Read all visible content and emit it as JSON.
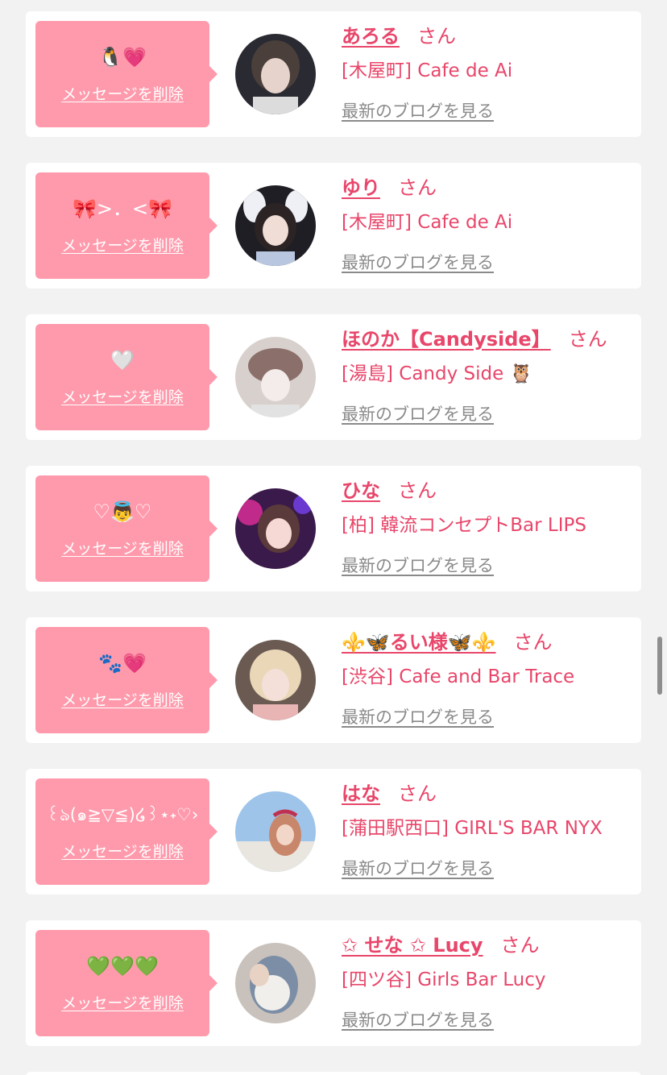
{
  "list": {
    "delete_label": "メッセージを削除",
    "blog_label": "最新のブログを見る",
    "honorific": "さん",
    "items": [
      {
        "message": "🐧💗",
        "name": "あろる",
        "shop": "[木屋町] Cafe de Ai"
      },
      {
        "message": "🎀>．<🎀",
        "name": "ゆり",
        "shop": "[木屋町] Cafe de Ai"
      },
      {
        "message": "🤍",
        "name": "ほのか【Candyside】",
        "shop": "[湯島] Candy Side 🦉"
      },
      {
        "message": "♡👼♡",
        "name": "ひな",
        "shop": "[柏] 韓流コンセプトBar LIPS"
      },
      {
        "message": "🐾💗",
        "name": "⚜️🦋るい様🦋⚜️",
        "shop": "[渋谷] Cafe and Bar Trace"
      },
      {
        "message": "꒰ঌ(๑≧▽≦)໒꒱⋆˖♡›",
        "name": "はな",
        "shop": "[蒲田駅西口] GIRL'S BAR NYX"
      },
      {
        "message": "💚💚💚",
        "name": "✩ せな ✩ Lucy",
        "shop": "[四ツ谷] Girls Bar Lucy"
      }
    ]
  },
  "colors": {
    "accent": "#e8466a",
    "bubble": "#ff9aac",
    "background": "#f2f2f2",
    "link_gray": "#8a8a8a"
  }
}
